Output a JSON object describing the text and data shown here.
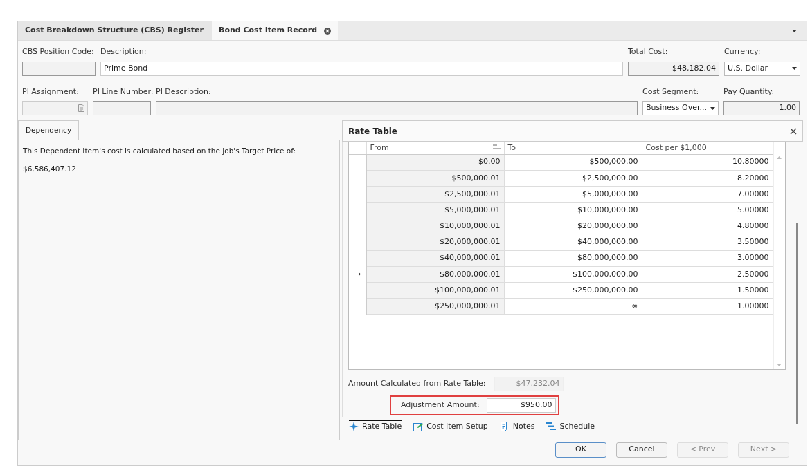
{
  "tabs": [
    {
      "label": "Cost Breakdown Structure (CBS) Register",
      "selected": false,
      "closable": false
    },
    {
      "label": "Bond Cost Item Record",
      "selected": true,
      "closable": true
    }
  ],
  "form": {
    "row_1": [
      {
        "label": "CBS Position Code:",
        "kind": "readonly"
      },
      {
        "label": "Description:",
        "value": "Prime Bond",
        "kind": "text"
      },
      {
        "label": "Total Cost:",
        "value": "$48,182.04",
        "kind": "readonly"
      },
      {
        "label": "Currency:",
        "value": "U.S. Dollar",
        "kind": "dropdown"
      }
    ],
    "row_2": [
      {
        "label": "PI Assignment:",
        "kind": "picker"
      },
      {
        "label": "PI Line Number:",
        "kind": "readonly"
      },
      {
        "label": "PI Description:",
        "kind": "readonly"
      },
      {
        "label": "Cost Segment:",
        "value": "Business Over...",
        "kind": "dropdown"
      },
      {
        "label": "Pay Quantity:",
        "value": "1.00",
        "kind": "readonly"
      }
    ]
  },
  "left_panel": {
    "tab": "Dependency",
    "text": "This Dependent Item's cost is calculated based on the job's Target Price of:",
    "target_price": "$6,586,407.12"
  },
  "rate_table": {
    "title": "Rate Table",
    "columns": [
      "From",
      "To",
      "Cost per $1,000"
    ],
    "rows": [
      {
        "cells": [
          "$0.00",
          "$500,000.00",
          "10.80000"
        ],
        "selected": false
      },
      {
        "cells": [
          "$500,000.01",
          "$2,500,000.00",
          "8.20000"
        ],
        "selected": false
      },
      {
        "cells": [
          "$2,500,000.01",
          "$5,000,000.00",
          "7.00000"
        ],
        "selected": false
      },
      {
        "cells": [
          "$5,000,000.01",
          "$10,000,000.00",
          "5.00000"
        ],
        "selected": false
      },
      {
        "cells": [
          "$10,000,000.01",
          "$20,000,000.00",
          "4.80000"
        ],
        "selected": false
      },
      {
        "cells": [
          "$20,000,000.01",
          "$40,000,000.00",
          "3.50000"
        ],
        "selected": false
      },
      {
        "cells": [
          "$40,000,000.01",
          "$80,000,000.00",
          "3.00000"
        ],
        "selected": false
      },
      {
        "cells": [
          "$80,000,000.01",
          "$100,000,000.00",
          "2.50000"
        ],
        "selected": true
      },
      {
        "cells": [
          "$100,000,000.01",
          "$250,000,000.00",
          "1.50000"
        ],
        "selected": false
      },
      {
        "cells": [
          "$250,000,000.01",
          "∞",
          "1.00000"
        ],
        "selected": false
      }
    ],
    "row_marker": "→",
    "calculated": {
      "label": "Amount Calculated from Rate Table:",
      "value": "$47,232.04"
    },
    "adjustment": {
      "label": "Adjustment Amount:",
      "value": "$950.00",
      "highlighted": true
    }
  },
  "bottom_tabs": [
    {
      "label": "Rate Table",
      "selected": true
    },
    {
      "label": "Cost Item Setup",
      "selected": false
    },
    {
      "label": "Notes",
      "selected": false
    },
    {
      "label": "Schedule",
      "selected": false
    }
  ],
  "buttons": [
    {
      "label": "OK",
      "disabled": false,
      "default": true
    },
    {
      "label": "Cancel",
      "disabled": false,
      "default": false
    },
    {
      "label": "< Prev",
      "disabled": true,
      "default": false
    },
    {
      "label": "Next >",
      "disabled": true,
      "default": false
    }
  ]
}
